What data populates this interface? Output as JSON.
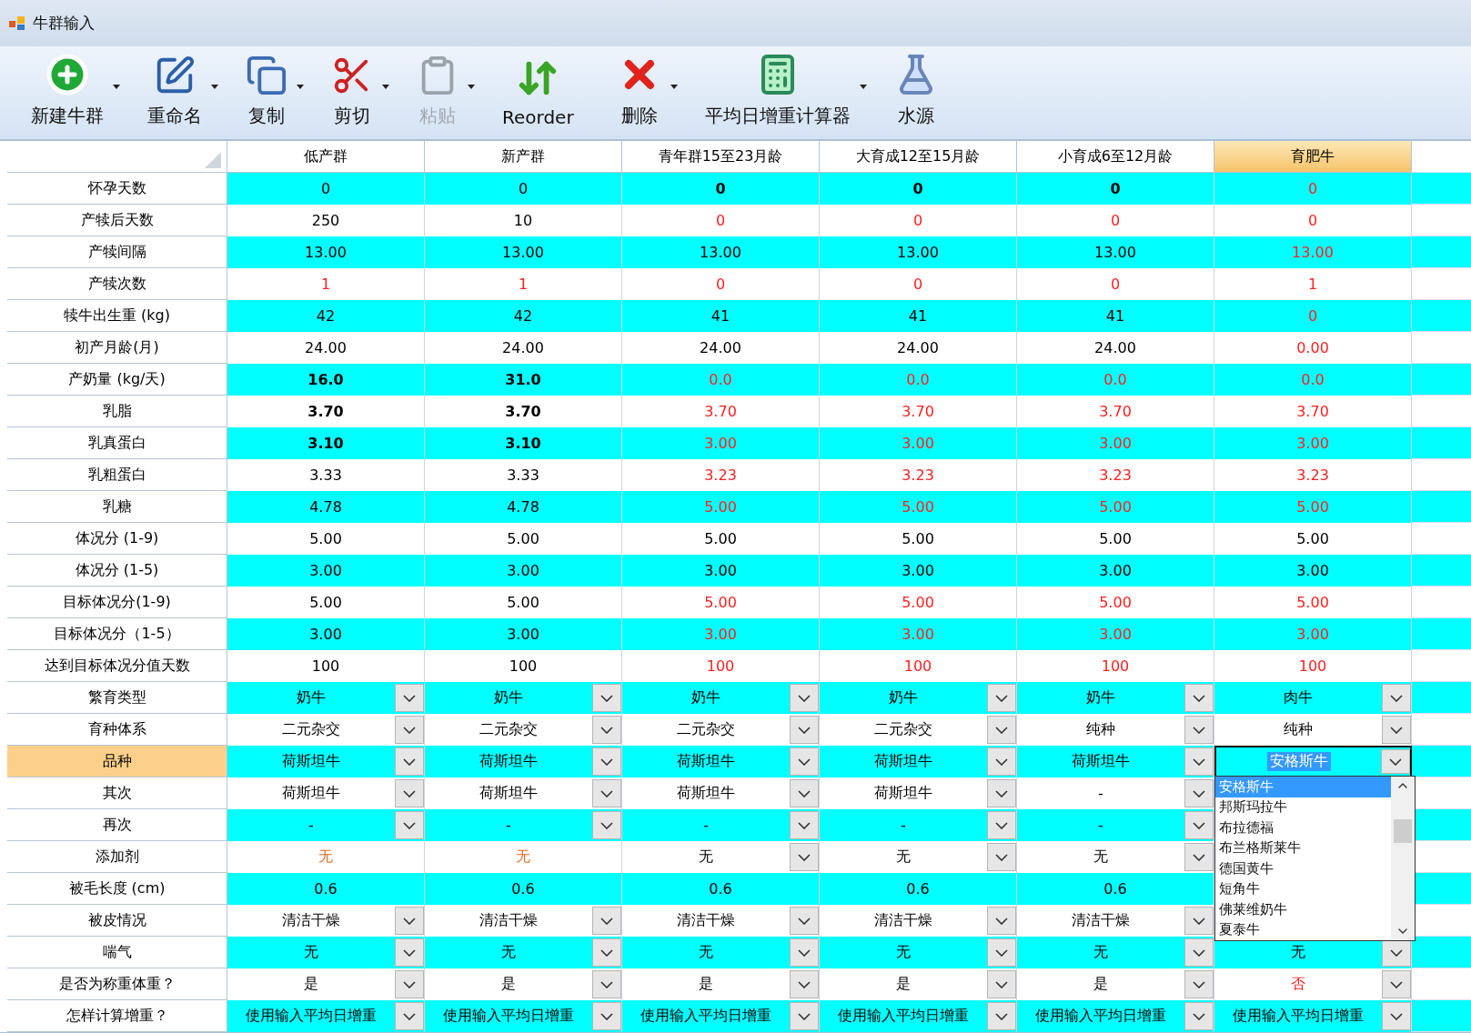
{
  "window": {
    "title": "牛群输入"
  },
  "toolbar": [
    {
      "label": "新建牛群",
      "menu": true,
      "disabled": false
    },
    {
      "label": "重命名",
      "menu": true,
      "disabled": false
    },
    {
      "label": "复制",
      "menu": true,
      "disabled": false
    },
    {
      "label": "剪切",
      "menu": true,
      "disabled": false
    },
    {
      "label": "粘贴",
      "menu": true,
      "disabled": true
    },
    {
      "label": "Reorder",
      "menu": false,
      "disabled": false
    },
    {
      "label": "删除",
      "menu": true,
      "disabled": false
    },
    {
      "label": "平均日增重计算器",
      "menu": true,
      "disabled": false
    },
    {
      "label": "水源",
      "menu": false,
      "disabled": false
    }
  ],
  "table": {
    "columns": [
      {
        "label": "低产群",
        "selected": false
      },
      {
        "label": "新产群",
        "selected": false
      },
      {
        "label": "青年群15至23月龄",
        "selected": false
      },
      {
        "label": "大育成12至15月龄",
        "selected": false
      },
      {
        "label": "小育成6至12月龄",
        "selected": false
      },
      {
        "label": "育肥牛",
        "selected": true
      }
    ],
    "open_list": {
      "items": [
        {
          "label": "安格斯牛",
          "selected": true
        },
        {
          "label": "邦斯玛拉牛",
          "selected": false
        },
        {
          "label": "布拉德福",
          "selected": false
        },
        {
          "label": "布兰格斯莱牛",
          "selected": false
        },
        {
          "label": "德国黄牛",
          "selected": false
        },
        {
          "label": "短角牛",
          "selected": false
        },
        {
          "label": "佛莱维奶牛",
          "selected": false
        },
        {
          "label": "夏泰牛",
          "selected": false
        }
      ]
    },
    "rows": [
      {
        "label": "怀孕天数",
        "selected": false,
        "cells": [
          {
            "text": "0"
          },
          {
            "text": "0"
          },
          {
            "text": "0",
            "bold": true
          },
          {
            "text": "0",
            "bold": true
          },
          {
            "text": "0",
            "bold": true
          },
          {
            "text": "0",
            "color": "#ff2020"
          }
        ]
      },
      {
        "label": "产犊后天数",
        "selected": false,
        "cells": [
          {
            "text": "250"
          },
          {
            "text": "10"
          },
          {
            "text": "0",
            "color": "#ff2020"
          },
          {
            "text": "0",
            "color": "#ff2020"
          },
          {
            "text": "0",
            "color": "#ff2020"
          },
          {
            "text": "0",
            "color": "#ff2020"
          }
        ]
      },
      {
        "label": "产犊间隔",
        "selected": false,
        "cells": [
          {
            "text": "13.00"
          },
          {
            "text": "13.00"
          },
          {
            "text": "13.00"
          },
          {
            "text": "13.00"
          },
          {
            "text": "13.00"
          },
          {
            "text": "13.00",
            "color": "#ff2020"
          }
        ]
      },
      {
        "label": "产犊次数",
        "selected": false,
        "cells": [
          {
            "text": "1",
            "color": "#ff2020"
          },
          {
            "text": "1",
            "color": "#ff2020"
          },
          {
            "text": "0",
            "color": "#ff2020"
          },
          {
            "text": "0",
            "color": "#ff2020"
          },
          {
            "text": "0",
            "color": "#ff2020"
          },
          {
            "text": "1",
            "color": "#ff2020"
          }
        ]
      },
      {
        "label": "犊牛出生重 (kg)",
        "selected": false,
        "cells": [
          {
            "text": "42"
          },
          {
            "text": "42"
          },
          {
            "text": "41"
          },
          {
            "text": "41"
          },
          {
            "text": "41"
          },
          {
            "text": "0",
            "color": "#ff2020"
          }
        ]
      },
      {
        "label": "初产月龄(月)",
        "selected": false,
        "cells": [
          {
            "text": "24.00"
          },
          {
            "text": "24.00"
          },
          {
            "text": "24.00"
          },
          {
            "text": "24.00"
          },
          {
            "text": "24.00"
          },
          {
            "text": "0.00",
            "color": "#ff2020"
          }
        ]
      },
      {
        "label": "产奶量 (kg/天)",
        "selected": false,
        "cells": [
          {
            "text": "16.0",
            "bold": true
          },
          {
            "text": "31.0",
            "bold": true
          },
          {
            "text": "0.0",
            "color": "#ff2020"
          },
          {
            "text": "0.0",
            "color": "#ff2020"
          },
          {
            "text": "0.0",
            "color": "#ff2020"
          },
          {
            "text": "0.0",
            "color": "#ff2020"
          }
        ]
      },
      {
        "label": "乳脂",
        "selected": false,
        "cells": [
          {
            "text": "3.70",
            "bold": true
          },
          {
            "text": "3.70",
            "bold": true
          },
          {
            "text": "3.70",
            "color": "#ff2020"
          },
          {
            "text": "3.70",
            "color": "#ff2020"
          },
          {
            "text": "3.70",
            "color": "#ff2020"
          },
          {
            "text": "3.70",
            "color": "#ff2020"
          }
        ]
      },
      {
        "label": "乳真蛋白",
        "selected": false,
        "cells": [
          {
            "text": "3.10",
            "bold": true
          },
          {
            "text": "3.10",
            "bold": true
          },
          {
            "text": "3.00",
            "color": "#ff2020"
          },
          {
            "text": "3.00",
            "color": "#ff2020"
          },
          {
            "text": "3.00",
            "color": "#ff2020"
          },
          {
            "text": "3.00",
            "color": "#ff2020"
          }
        ]
      },
      {
        "label": "乳粗蛋白",
        "selected": false,
        "cells": [
          {
            "text": "3.33"
          },
          {
            "text": "3.33"
          },
          {
            "text": "3.23",
            "color": "#ff2020"
          },
          {
            "text": "3.23",
            "color": "#ff2020"
          },
          {
            "text": "3.23",
            "color": "#ff2020"
          },
          {
            "text": "3.23",
            "color": "#ff2020"
          }
        ]
      },
      {
        "label": "乳糖",
        "selected": false,
        "cells": [
          {
            "text": "4.78"
          },
          {
            "text": "4.78"
          },
          {
            "text": "5.00",
            "color": "#ff2020"
          },
          {
            "text": "5.00",
            "color": "#ff2020"
          },
          {
            "text": "5.00",
            "color": "#ff2020"
          },
          {
            "text": "5.00",
            "color": "#ff2020"
          }
        ]
      },
      {
        "label": "体况分 (1-9)",
        "selected": false,
        "cells": [
          {
            "text": "5.00"
          },
          {
            "text": "5.00"
          },
          {
            "text": "5.00"
          },
          {
            "text": "5.00"
          },
          {
            "text": "5.00"
          },
          {
            "text": "5.00"
          }
        ]
      },
      {
        "label": "体况分 (1-5)",
        "selected": false,
        "cells": [
          {
            "text": "3.00"
          },
          {
            "text": "3.00"
          },
          {
            "text": "3.00"
          },
          {
            "text": "3.00"
          },
          {
            "text": "3.00"
          },
          {
            "text": "3.00"
          }
        ]
      },
      {
        "label": "目标体况分(1-9)",
        "selected": false,
        "cells": [
          {
            "text": "5.00"
          },
          {
            "text": "5.00"
          },
          {
            "text": "5.00",
            "color": "#ff2020"
          },
          {
            "text": "5.00",
            "color": "#ff2020"
          },
          {
            "text": "5.00",
            "color": "#ff2020"
          },
          {
            "text": "5.00",
            "color": "#ff2020"
          }
        ]
      },
      {
        "label": "目标体况分（1-5）",
        "selected": false,
        "cells": [
          {
            "text": "3.00"
          },
          {
            "text": "3.00"
          },
          {
            "text": "3.00",
            "color": "#ff2020"
          },
          {
            "text": "3.00",
            "color": "#ff2020"
          },
          {
            "text": "3.00",
            "color": "#ff2020"
          },
          {
            "text": "3.00",
            "color": "#ff2020"
          }
        ]
      },
      {
        "label": "达到目标体况分值天数",
        "selected": false,
        "cells": [
          {
            "text": "100"
          },
          {
            "text": "100"
          },
          {
            "text": "100",
            "color": "#ff2020"
          },
          {
            "text": "100",
            "color": "#ff2020"
          },
          {
            "text": "100",
            "color": "#ff2020"
          },
          {
            "text": "100",
            "color": "#ff2020"
          }
        ]
      },
      {
        "label": "繁育类型",
        "selected": false,
        "cells": [
          {
            "text": "奶牛",
            "dropdown": true
          },
          {
            "text": "奶牛",
            "dropdown": true
          },
          {
            "text": "奶牛",
            "dropdown": true
          },
          {
            "text": "奶牛",
            "dropdown": true
          },
          {
            "text": "奶牛",
            "dropdown": true
          },
          {
            "text": "肉牛",
            "dropdown": true
          }
        ]
      },
      {
        "label": "育种体系",
        "selected": false,
        "cells": [
          {
            "text": "二元杂交",
            "dropdown": true
          },
          {
            "text": "二元杂交",
            "dropdown": true
          },
          {
            "text": "二元杂交",
            "dropdown": true
          },
          {
            "text": "二元杂交",
            "dropdown": true
          },
          {
            "text": "纯种",
            "dropdown": true
          },
          {
            "text": "纯种",
            "dropdown": true
          }
        ]
      },
      {
        "label": "品种",
        "selected": true,
        "cells": [
          {
            "text": "荷斯坦牛",
            "dropdown": true
          },
          {
            "text": "荷斯坦牛",
            "dropdown": true
          },
          {
            "text": "荷斯坦牛",
            "dropdown": true
          },
          {
            "text": "荷斯坦牛",
            "dropdown": true
          },
          {
            "text": "荷斯坦牛",
            "dropdown": true
          },
          {
            "text": "安格斯牛",
            "dropdown": true,
            "open": true
          }
        ]
      },
      {
        "label": "其次",
        "selected": false,
        "cells": [
          {
            "text": "荷斯坦牛",
            "dropdown": true
          },
          {
            "text": "荷斯坦牛",
            "dropdown": true
          },
          {
            "text": "荷斯坦牛",
            "dropdown": true
          },
          {
            "text": "荷斯坦牛",
            "dropdown": true
          },
          {
            "text": "-",
            "dropdown": true
          },
          null
        ]
      },
      {
        "label": "再次",
        "selected": false,
        "cells": [
          {
            "text": "-",
            "dropdown": true
          },
          {
            "text": "-",
            "dropdown": true
          },
          {
            "text": "-",
            "dropdown": true
          },
          {
            "text": "-",
            "dropdown": true
          },
          {
            "text": "-",
            "dropdown": true
          },
          null
        ]
      },
      {
        "label": "添加剂",
        "selected": false,
        "cells": [
          {
            "text": "无",
            "color": "#e2691e"
          },
          {
            "text": "无",
            "color": "#e2691e"
          },
          {
            "text": "无",
            "dropdown": true
          },
          {
            "text": "无",
            "dropdown": true
          },
          {
            "text": "无",
            "dropdown": true
          },
          null
        ]
      },
      {
        "label": "被毛长度 (cm)",
        "selected": false,
        "cells": [
          {
            "text": "0.6"
          },
          {
            "text": "0.6"
          },
          {
            "text": "0.6"
          },
          {
            "text": "0.6"
          },
          {
            "text": "0.6"
          },
          null
        ]
      },
      {
        "label": "被皮情况",
        "selected": false,
        "cells": [
          {
            "text": "清洁干燥",
            "dropdown": true
          },
          {
            "text": "清洁干燥",
            "dropdown": true
          },
          {
            "text": "清洁干燥",
            "dropdown": true
          },
          {
            "text": "清洁干燥",
            "dropdown": true
          },
          {
            "text": "清洁干燥",
            "dropdown": true
          },
          null
        ]
      },
      {
        "label": "喘气",
        "selected": false,
        "cells": [
          {
            "text": "无",
            "dropdown": true
          },
          {
            "text": "无",
            "dropdown": true
          },
          {
            "text": "无",
            "dropdown": true
          },
          {
            "text": "无",
            "dropdown": true
          },
          {
            "text": "无",
            "dropdown": true
          },
          {
            "text": "无",
            "dropdown": true
          }
        ]
      },
      {
        "label": "是否为称重体重？",
        "selected": false,
        "cells": [
          {
            "text": "是",
            "dropdown": true
          },
          {
            "text": "是",
            "dropdown": true
          },
          {
            "text": "是",
            "dropdown": true
          },
          {
            "text": "是",
            "dropdown": true
          },
          {
            "text": "是",
            "dropdown": true
          },
          {
            "text": "否",
            "color": "#ff2020",
            "dropdown": true
          }
        ]
      },
      {
        "label": "怎样计算增重？",
        "selected": false,
        "cells": [
          {
            "text": "使用输入平均日增重",
            "dropdown": true
          },
          {
            "text": "使用输入平均日增重",
            "dropdown": true
          },
          {
            "text": "使用输入平均日增重",
            "dropdown": true
          },
          {
            "text": "使用输入平均日增重",
            "dropdown": true
          },
          {
            "text": "使用输入平均日增重",
            "dropdown": true
          },
          {
            "text": "使用输入平均日增重",
            "dropdown": true
          }
        ]
      }
    ]
  }
}
